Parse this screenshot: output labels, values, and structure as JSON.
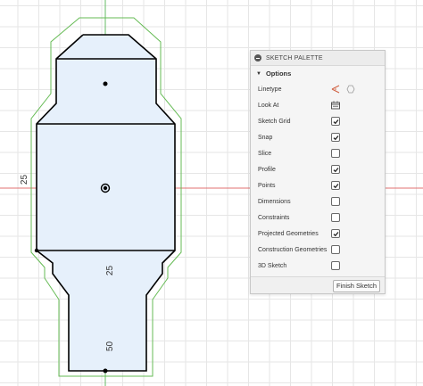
{
  "canvas": {
    "dimensions": [
      {
        "name": "left-dimension",
        "text": "25"
      },
      {
        "name": "lower-dimension",
        "text": "25"
      },
      {
        "name": "bottom-dimension",
        "text": "50"
      }
    ]
  },
  "palette": {
    "title": "SKETCH PALETTE",
    "section_title": "Options",
    "finish_label": "Finish Sketch",
    "options": [
      {
        "label": "Linetype",
        "control": "linetype",
        "checked": null
      },
      {
        "label": "Look At",
        "control": "lookat",
        "checked": null
      },
      {
        "label": "Sketch Grid",
        "control": "checkbox",
        "checked": true
      },
      {
        "label": "Snap",
        "control": "checkbox",
        "checked": true
      },
      {
        "label": "Slice",
        "control": "checkbox",
        "checked": false
      },
      {
        "label": "Profile",
        "control": "checkbox",
        "checked": true
      },
      {
        "label": "Points",
        "control": "checkbox",
        "checked": true
      },
      {
        "label": "Dimensions",
        "control": "checkbox",
        "checked": false
      },
      {
        "label": "Constraints",
        "control": "checkbox",
        "checked": false
      },
      {
        "label": "Projected Geometries",
        "control": "checkbox",
        "checked": true
      },
      {
        "label": "Construction Geometries",
        "control": "checkbox",
        "checked": false
      },
      {
        "label": "3D Sketch",
        "control": "checkbox",
        "checked": false
      }
    ]
  },
  "colors": {
    "profile_fill": "#e6f0fb",
    "sketch_line": "#000000",
    "projected_line": "#66bb55",
    "axis_x": "#e07070",
    "axis_y": "#66bb66",
    "accent": "#555555"
  }
}
